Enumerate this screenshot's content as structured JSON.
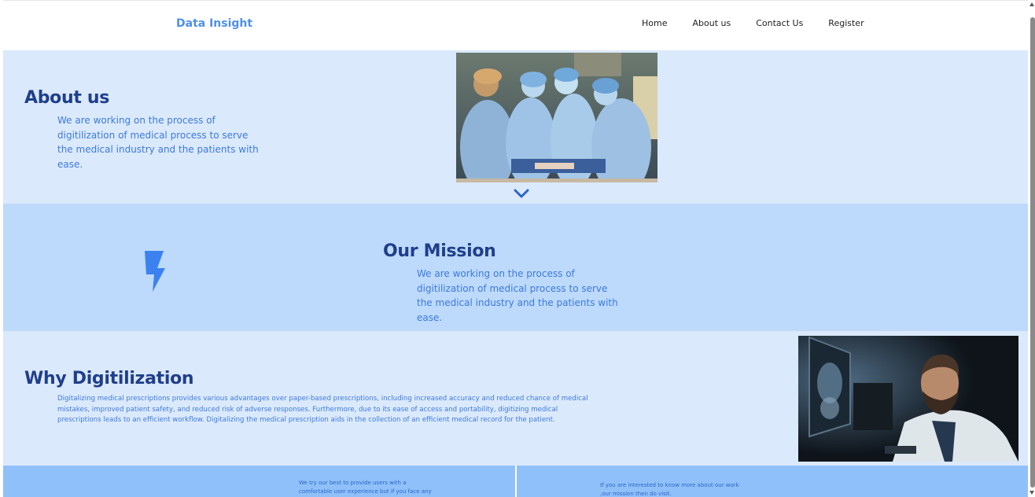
{
  "nav": {
    "brand": "Data Insight",
    "links": [
      "Home",
      "About us",
      "Contact Us",
      "Register"
    ]
  },
  "about": {
    "title": "About us",
    "text": "We are working on the process of digitilization of medical process to serve the medical industry and the patients with ease.",
    "image": "surgeons-operating-photo"
  },
  "mission": {
    "title": "Our Mission",
    "text": "We are working on the process of digitilization of medical process to serve the medical industry and the patients with ease.",
    "icon": "lightning-bolt-icon"
  },
  "why": {
    "title": "Why Digitilization",
    "text": "Digitalizing medical prescriptions provides various advantages over paper-based prescriptions, including increased accuracy and reduced chance of medical mistakes, improved patient safety, and reduced risk of adverse responses. Furthermore, due to its ease of access and portability, digitizing medical prescriptions leads to an efficient workflow. Digitalizing the medical prescription aids in the collection of an efficient medical record for the patient.",
    "image": "doctor-with-xray-monitor-photo"
  },
  "footer": {
    "left_text": "We try our best to provide users with a comfortable user experience but if you face any",
    "right_text": "If you are interested to know more about our work ,our mission then do visit."
  },
  "colors": {
    "brand": "#4f8fe8",
    "heading": "#1f3f8a",
    "text": "#3d7bdc",
    "section_light": "#dbe9fc",
    "section_mid": "#bdd9fb",
    "footer": "#8fc0fa"
  }
}
